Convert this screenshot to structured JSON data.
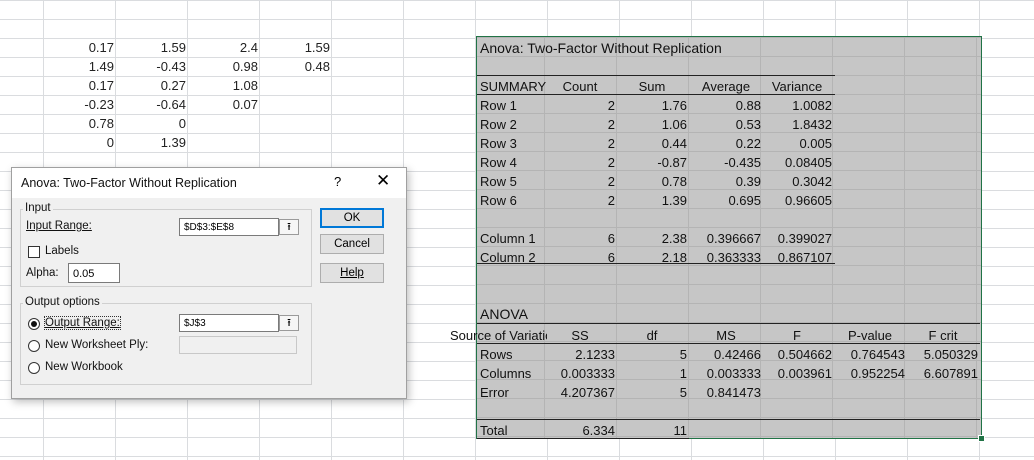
{
  "sheet": {
    "rows": [
      [
        "0.17",
        "1.59",
        "2.4",
        "1.59"
      ],
      [
        "1.49",
        "-0.43",
        "0.98",
        "0.48"
      ],
      [
        "0.17",
        "0.27",
        "1.08",
        ""
      ],
      [
        "-0.23",
        "-0.64",
        "0.07",
        ""
      ],
      [
        "0.78",
        "0",
        "",
        ""
      ],
      [
        "0",
        "1.39",
        "",
        ""
      ]
    ]
  },
  "output": {
    "title": "Anova: Two-Factor Without Replication",
    "summary_headers": [
      "SUMMARY",
      "Count",
      "Sum",
      "Average",
      "Variance"
    ],
    "summary_rows": [
      [
        "Row 1",
        "2",
        "1.76",
        "0.88",
        "1.0082"
      ],
      [
        "Row 2",
        "2",
        "1.06",
        "0.53",
        "1.8432"
      ],
      [
        "Row 3",
        "2",
        "0.44",
        "0.22",
        "0.005"
      ],
      [
        "Row 4",
        "2",
        "-0.87",
        "-0.435",
        "0.08405"
      ],
      [
        "Row 5",
        "2",
        "0.78",
        "0.39",
        "0.3042"
      ],
      [
        "Row 6",
        "2",
        "1.39",
        "0.695",
        "0.96605"
      ]
    ],
    "column_rows": [
      [
        "Column 1",
        "6",
        "2.38",
        "0.396667",
        "0.399027"
      ],
      [
        "Column 2",
        "6",
        "2.18",
        "0.363333",
        "0.867107"
      ]
    ],
    "anova_title": "ANOVA",
    "anova_headers": [
      "Source of Variation",
      "SS",
      "df",
      "MS",
      "F",
      "P-value",
      "F crit"
    ],
    "anova_rows": [
      [
        "Rows",
        "2.1233",
        "5",
        "0.42466",
        "0.504662",
        "0.764543",
        "5.050329"
      ],
      [
        "Columns",
        "0.003333",
        "1",
        "0.003333",
        "0.003961",
        "0.952254",
        "6.607891"
      ],
      [
        "Error",
        "4.207367",
        "5",
        "0.841473",
        "",
        "",
        ""
      ]
    ],
    "total_row": [
      "Total",
      "6.334",
      "11"
    ]
  },
  "dialog": {
    "title": "Anova: Two-Factor Without Replication",
    "help_glyph": "?",
    "close_glyph": "✕",
    "input_group": "Input",
    "input_range_label": "Input Range:",
    "input_range_value": "$D$3:$E$8",
    "labels_label": "Labels",
    "alpha_label": "Alpha:",
    "alpha_value": "0.05",
    "output_group": "Output options",
    "output_range_label": "Output Range:",
    "output_range_value": "$J$3",
    "new_worksheet_label": "New Worksheet Ply:",
    "new_workbook_label": "New Workbook",
    "ok_label": "OK",
    "cancel_label": "Cancel",
    "help_label": "Help",
    "collapse_glyph": "⭱"
  }
}
